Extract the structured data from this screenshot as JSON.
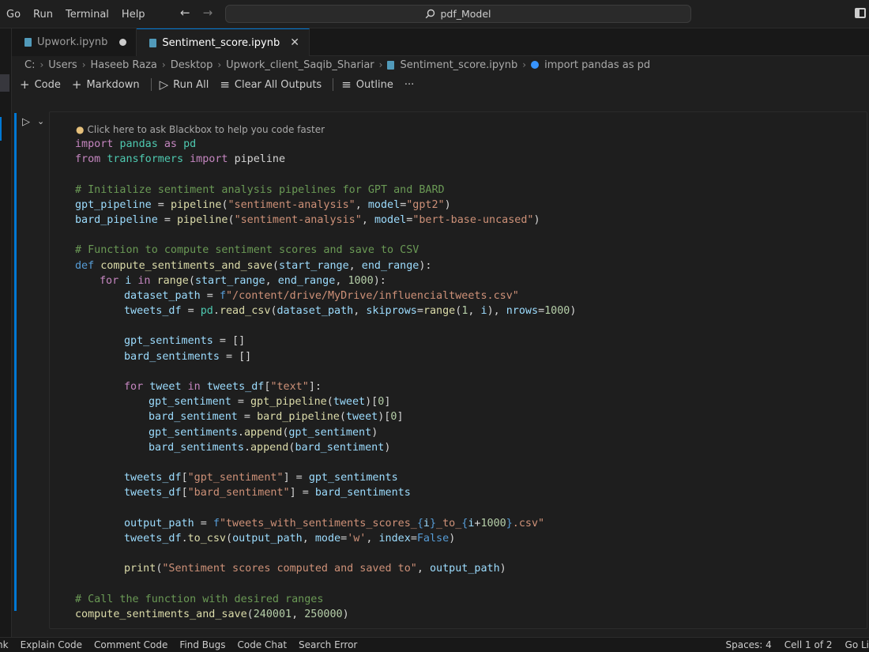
{
  "menu": [
    "Go",
    "Run",
    "Terminal",
    "Help"
  ],
  "search": {
    "label": "pdf_Model"
  },
  "tabs": [
    {
      "label": "Upwork.ipynb",
      "dirty": true
    },
    {
      "label": "Sentiment_score.ipynb",
      "active": true
    }
  ],
  "breadcrumb": [
    "C:",
    "Users",
    "Haseeb Raza",
    "Desktop",
    "Upwork_client_Saqib_Shariar",
    "Sentiment_score.ipynb",
    "import pandas as pd"
  ],
  "toolbar": {
    "code": "Code",
    "markdown": "Markdown",
    "run_all": "Run All",
    "clear_outputs": "Clear All Outputs",
    "outline": "Outline",
    "more": "···"
  },
  "cell": {
    "hint": "Click here to ask Blackbox to help you code faster",
    "lines": [
      [
        [
          "kw",
          "import "
        ],
        [
          "mod",
          "pandas"
        ],
        [
          "kw",
          " as "
        ],
        [
          "mod",
          "pd"
        ]
      ],
      [
        [
          "kw",
          "from "
        ],
        [
          "mod",
          "transformers"
        ],
        [
          "kw",
          " import "
        ],
        [
          "plain",
          "pipeline"
        ]
      ],
      [],
      [
        [
          "cmt",
          "# Initialize sentiment analysis pipelines for GPT and BARD"
        ]
      ],
      [
        [
          "var",
          "gpt_pipeline"
        ],
        [
          "plain",
          " = "
        ],
        [
          "fn",
          "pipeline"
        ],
        [
          "plain",
          "("
        ],
        [
          "str",
          "\"sentiment-analysis\""
        ],
        [
          "plain",
          ", "
        ],
        [
          "var",
          "model"
        ],
        [
          "plain",
          "="
        ],
        [
          "str",
          "\"gpt2\""
        ],
        [
          "plain",
          ")"
        ]
      ],
      [
        [
          "var",
          "bard_pipeline"
        ],
        [
          "plain",
          " = "
        ],
        [
          "fn",
          "pipeline"
        ],
        [
          "plain",
          "("
        ],
        [
          "str",
          "\"sentiment-analysis\""
        ],
        [
          "plain",
          ", "
        ],
        [
          "var",
          "model"
        ],
        [
          "plain",
          "="
        ],
        [
          "str",
          "\"bert-base-uncased\""
        ],
        [
          "plain",
          ")"
        ]
      ],
      [],
      [
        [
          "cmt",
          "# Function to compute sentiment scores and save to CSV"
        ]
      ],
      [
        [
          "kw2",
          "def "
        ],
        [
          "fn",
          "compute_sentiments_and_save"
        ],
        [
          "plain",
          "("
        ],
        [
          "var",
          "start_range"
        ],
        [
          "plain",
          ", "
        ],
        [
          "var",
          "end_range"
        ],
        [
          "plain",
          "):"
        ]
      ],
      [
        [
          "ind1",
          ""
        ],
        [
          "kw",
          "for "
        ],
        [
          "var",
          "i"
        ],
        [
          "kw",
          " in "
        ],
        [
          "fn",
          "range"
        ],
        [
          "plain",
          "("
        ],
        [
          "var",
          "start_range"
        ],
        [
          "plain",
          ", "
        ],
        [
          "var",
          "end_range"
        ],
        [
          "plain",
          ", "
        ],
        [
          "num",
          "1000"
        ],
        [
          "plain",
          "):"
        ]
      ],
      [
        [
          "ind2",
          ""
        ],
        [
          "var",
          "dataset_path"
        ],
        [
          "plain",
          " = "
        ],
        [
          "kw2",
          "f"
        ],
        [
          "str",
          "\"/content/drive/MyDrive/influencialtweets.csv\""
        ]
      ],
      [
        [
          "ind2",
          ""
        ],
        [
          "var",
          "tweets_df"
        ],
        [
          "plain",
          " = "
        ],
        [
          "mod",
          "pd"
        ],
        [
          "plain",
          "."
        ],
        [
          "fn",
          "read_csv"
        ],
        [
          "plain",
          "("
        ],
        [
          "var",
          "dataset_path"
        ],
        [
          "plain",
          ", "
        ],
        [
          "var",
          "skiprows"
        ],
        [
          "plain",
          "="
        ],
        [
          "fn",
          "range"
        ],
        [
          "plain",
          "("
        ],
        [
          "num",
          "1"
        ],
        [
          "plain",
          ", "
        ],
        [
          "var",
          "i"
        ],
        [
          "plain",
          "), "
        ],
        [
          "var",
          "nrows"
        ],
        [
          "plain",
          "="
        ],
        [
          "num",
          "1000"
        ],
        [
          "plain",
          ")"
        ]
      ],
      [],
      [
        [
          "ind2",
          ""
        ],
        [
          "var",
          "gpt_sentiments"
        ],
        [
          "plain",
          " = []"
        ]
      ],
      [
        [
          "ind2",
          ""
        ],
        [
          "var",
          "bard_sentiments"
        ],
        [
          "plain",
          " = []"
        ]
      ],
      [],
      [
        [
          "ind2",
          ""
        ],
        [
          "kw",
          "for "
        ],
        [
          "var",
          "tweet"
        ],
        [
          "kw",
          " in "
        ],
        [
          "var",
          "tweets_df"
        ],
        [
          "plain",
          "["
        ],
        [
          "str",
          "\"text\""
        ],
        [
          "plain",
          "]:"
        ]
      ],
      [
        [
          "ind3",
          ""
        ],
        [
          "var",
          "gpt_sentiment"
        ],
        [
          "plain",
          " = "
        ],
        [
          "fn",
          "gpt_pipeline"
        ],
        [
          "plain",
          "("
        ],
        [
          "var",
          "tweet"
        ],
        [
          "plain",
          ")["
        ],
        [
          "num",
          "0"
        ],
        [
          "plain",
          "]"
        ]
      ],
      [
        [
          "ind3",
          ""
        ],
        [
          "var",
          "bard_sentiment"
        ],
        [
          "plain",
          " = "
        ],
        [
          "fn",
          "bard_pipeline"
        ],
        [
          "plain",
          "("
        ],
        [
          "var",
          "tweet"
        ],
        [
          "plain",
          ")["
        ],
        [
          "num",
          "0"
        ],
        [
          "plain",
          "]"
        ]
      ],
      [
        [
          "ind3",
          ""
        ],
        [
          "var",
          "gpt_sentiments"
        ],
        [
          "plain",
          "."
        ],
        [
          "fn",
          "append"
        ],
        [
          "plain",
          "("
        ],
        [
          "var",
          "gpt_sentiment"
        ],
        [
          "plain",
          ")"
        ]
      ],
      [
        [
          "ind3",
          ""
        ],
        [
          "var",
          "bard_sentiments"
        ],
        [
          "plain",
          "."
        ],
        [
          "fn",
          "append"
        ],
        [
          "plain",
          "("
        ],
        [
          "var",
          "bard_sentiment"
        ],
        [
          "plain",
          ")"
        ]
      ],
      [],
      [
        [
          "ind2",
          ""
        ],
        [
          "var",
          "tweets_df"
        ],
        [
          "plain",
          "["
        ],
        [
          "str",
          "\"gpt_sentiment\""
        ],
        [
          "plain",
          "] = "
        ],
        [
          "var",
          "gpt_sentiments"
        ]
      ],
      [
        [
          "ind2",
          ""
        ],
        [
          "var",
          "tweets_df"
        ],
        [
          "plain",
          "["
        ],
        [
          "str",
          "\"bard_sentiment\""
        ],
        [
          "plain",
          "] = "
        ],
        [
          "var",
          "bard_sentiments"
        ]
      ],
      [],
      [
        [
          "ind2",
          ""
        ],
        [
          "var",
          "output_path"
        ],
        [
          "plain",
          " = "
        ],
        [
          "kw2",
          "f"
        ],
        [
          "str",
          "\"tweets_with_sentiments_scores_"
        ],
        [
          "kw2",
          "{"
        ],
        [
          "var",
          "i"
        ],
        [
          "kw2",
          "}"
        ],
        [
          "str",
          "_to_"
        ],
        [
          "kw2",
          "{"
        ],
        [
          "var",
          "i"
        ],
        [
          "plain",
          "+"
        ],
        [
          "num",
          "1000"
        ],
        [
          "kw2",
          "}"
        ],
        [
          "str",
          ".csv\""
        ]
      ],
      [
        [
          "ind2",
          ""
        ],
        [
          "var",
          "tweets_df"
        ],
        [
          "plain",
          "."
        ],
        [
          "fn",
          "to_csv"
        ],
        [
          "plain",
          "("
        ],
        [
          "var",
          "output_path"
        ],
        [
          "plain",
          ", "
        ],
        [
          "var",
          "mode"
        ],
        [
          "plain",
          "="
        ],
        [
          "str",
          "'w'"
        ],
        [
          "plain",
          ", "
        ],
        [
          "var",
          "index"
        ],
        [
          "plain",
          "="
        ],
        [
          "kw2",
          "False"
        ],
        [
          "plain",
          ")"
        ]
      ],
      [],
      [
        [
          "ind2",
          ""
        ],
        [
          "fn",
          "print"
        ],
        [
          "plain",
          "("
        ],
        [
          "str",
          "\"Sentiment scores computed and saved to\""
        ],
        [
          "plain",
          ", "
        ],
        [
          "var",
          "output_path"
        ],
        [
          "plain",
          ")"
        ]
      ],
      [],
      [
        [
          "cmt",
          "# Call the function with desired ranges"
        ]
      ],
      [
        [
          "fn",
          "compute_sentiments_and_save"
        ],
        [
          "plain",
          "("
        ],
        [
          "num",
          "240001"
        ],
        [
          "plain",
          ", "
        ],
        [
          "num",
          "250000"
        ],
        [
          "plain",
          ")"
        ]
      ]
    ]
  },
  "statusbar": {
    "left": [
      "nk",
      "Explain Code",
      "Comment Code",
      "Find Bugs",
      "Code Chat",
      "Search Error"
    ],
    "right": [
      "Spaces: 4",
      "Cell 1 of 2",
      "Go Li"
    ]
  },
  "colors": {
    "kw": "#c586c0",
    "kw2": "#569cd6",
    "mod": "#4ec9b0",
    "fn": "#dcdcaa",
    "var": "#9cdcfe",
    "str": "#ce9178",
    "num": "#b5cea8",
    "cmt": "#6a9955",
    "plain": "#d4d4d4"
  }
}
